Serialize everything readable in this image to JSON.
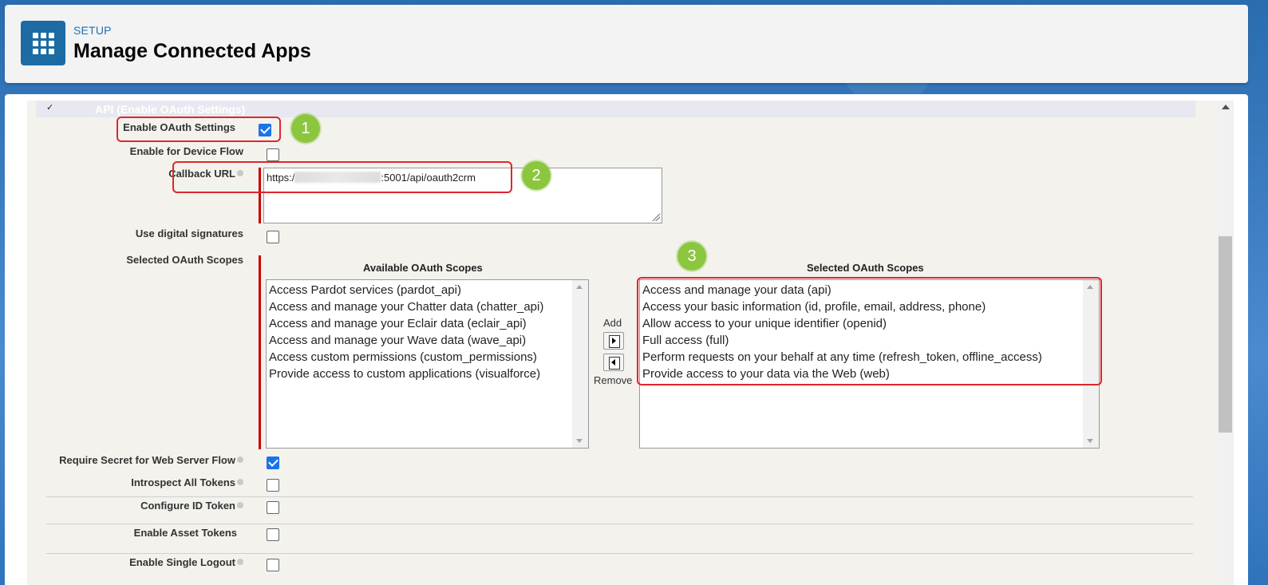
{
  "header": {
    "section": "SETUP",
    "title": "Manage Connected Apps"
  },
  "api_section": {
    "title": "API (Enable OAuth Settings)"
  },
  "fields": {
    "enable_oauth": {
      "label": "Enable OAuth Settings",
      "checked": true
    },
    "device_flow": {
      "label": "Enable for Device Flow",
      "checked": false
    },
    "callback_url": {
      "label": "Callback URL",
      "value_prefix": "https:/",
      "value_suffix": ":5001/api/oauth2crm"
    },
    "digital_signatures": {
      "label": "Use digital signatures",
      "checked": false
    },
    "selected_scopes_label": "Selected OAuth Scopes",
    "require_secret": {
      "label": "Require Secret for Web Server Flow",
      "checked": true
    },
    "introspect": {
      "label": "Introspect All Tokens",
      "checked": false
    },
    "configure_id_token": {
      "label": "Configure ID Token",
      "checked": false
    },
    "asset_tokens": {
      "label": "Enable Asset Tokens",
      "checked": false
    },
    "single_logout": {
      "label": "Enable Single Logout",
      "checked": false
    }
  },
  "scopes": {
    "available_header": "Available OAuth Scopes",
    "selected_header": "Selected OAuth Scopes",
    "add_label": "Add",
    "remove_label": "Remove",
    "available": [
      "Access Pardot services (pardot_api)",
      "Access and manage your Chatter data (chatter_api)",
      "Access and manage your Eclair data (eclair_api)",
      "Access and manage your Wave data (wave_api)",
      "Access custom permissions (custom_permissions)",
      "Provide access to custom applications (visualforce)"
    ],
    "selected": [
      "Access and manage your data (api)",
      "Access your basic information (id, profile, email, address, phone)",
      "Allow access to your unique identifier (openid)",
      "Full access (full)",
      "Perform requests on your behalf at any time (refresh_token, offline_access)",
      "Provide access to your data via the Web (web)"
    ]
  },
  "annotations": [
    "1",
    "2",
    "3"
  ],
  "colors": {
    "accent": "#1c6ba4",
    "highlight": "#e0262c",
    "badge": "#8cc63f",
    "required": "#cc0000"
  }
}
